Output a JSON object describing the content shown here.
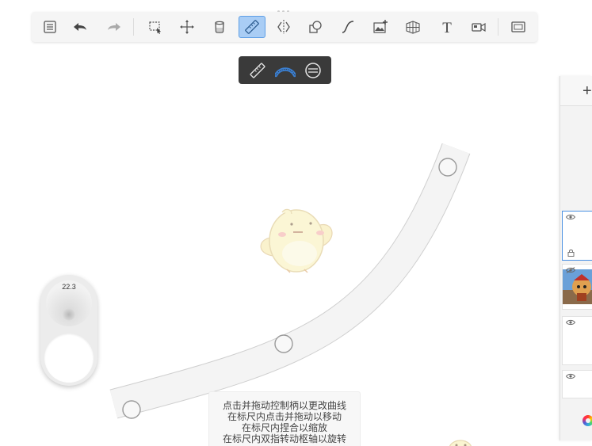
{
  "toolbar": {
    "tools": [
      {
        "name": "layers-list-icon"
      },
      {
        "name": "undo-icon"
      },
      {
        "name": "redo-icon"
      },
      {
        "name": "selection-icon"
      },
      {
        "name": "transform-icon"
      },
      {
        "name": "fill-bucket-icon"
      },
      {
        "name": "ruler-icon",
        "active": true
      },
      {
        "name": "symmetry-icon"
      },
      {
        "name": "shapes-icon"
      },
      {
        "name": "curve-icon"
      },
      {
        "name": "add-image-icon"
      },
      {
        "name": "perspective-grid-icon"
      },
      {
        "name": "text-icon",
        "glyph": "T"
      },
      {
        "name": "time-lapse-icon"
      },
      {
        "name": "fullscreen-icon"
      }
    ]
  },
  "ruler_popup": {
    "options": [
      "straight-ruler-icon",
      "french-curve-ruler-icon",
      "ellipse-ruler-icon"
    ],
    "selected": "french-curve-ruler-icon"
  },
  "brush_puck": {
    "size_value": "22.3"
  },
  "hint": {
    "lines": [
      "点击并拖动控制柄以更改曲线",
      "在标尺内点击并拖动以移动",
      "在标尺内捏合以缩放",
      "在标尺内双指转动枢轴以旋转"
    ]
  },
  "layers": {
    "add_label": "+",
    "items": [
      {
        "name": "layer-1",
        "visible": true,
        "selected": true,
        "locked": true
      },
      {
        "name": "layer-2",
        "visible": false,
        "has_image": true
      },
      {
        "name": "layer-3",
        "visible": true
      },
      {
        "name": "layer-4",
        "visible": true
      }
    ]
  },
  "colors": {
    "accent": "#4a90e2",
    "ruler_fill": "#f4f4f4",
    "ruler_stroke": "#cfcfcf",
    "popup_bg": "#3a3a3a",
    "curve_icon_blue": "#3b7fd1"
  }
}
